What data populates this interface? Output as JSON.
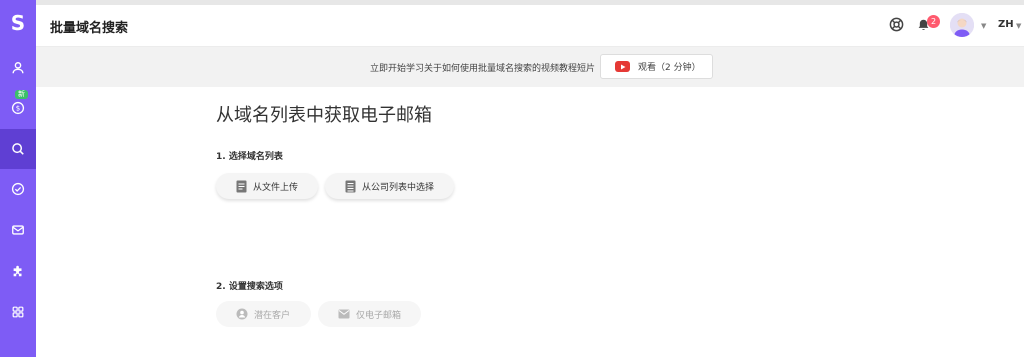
{
  "app": {
    "logo": "S",
    "title": "批量域名搜索"
  },
  "sidebar": {
    "new_badge": "新",
    "items": [
      {
        "name": "user-icon"
      },
      {
        "name": "credits-icon"
      },
      {
        "name": "search-icon"
      },
      {
        "name": "check-circle-icon"
      },
      {
        "name": "mail-icon"
      },
      {
        "name": "puzzle-icon"
      },
      {
        "name": "apps-grid-icon"
      }
    ]
  },
  "header": {
    "notification_count": "2",
    "language": "ZH"
  },
  "banner": {
    "text": "立即开始学习关于如何使用批量域名搜索的视频教程短片",
    "watch_label": "观看（2 分钟）"
  },
  "main": {
    "heading": "从域名列表中获取电子邮箱",
    "step1": {
      "label": "1. 选择域名列表",
      "upload_file": "从文件上传",
      "from_company_list": "从公司列表中选择"
    },
    "step2": {
      "label": "2. 设置搜索选项",
      "prospects": "潜在客户",
      "emails_only": "仅电子邮箱"
    }
  },
  "colors": {
    "sidebar": "#7e5cf5",
    "sidebar_active": "#5f3fd3",
    "notification": "#ff5a6e",
    "youtube": "#e53935",
    "new_badge": "#3cc06a"
  }
}
